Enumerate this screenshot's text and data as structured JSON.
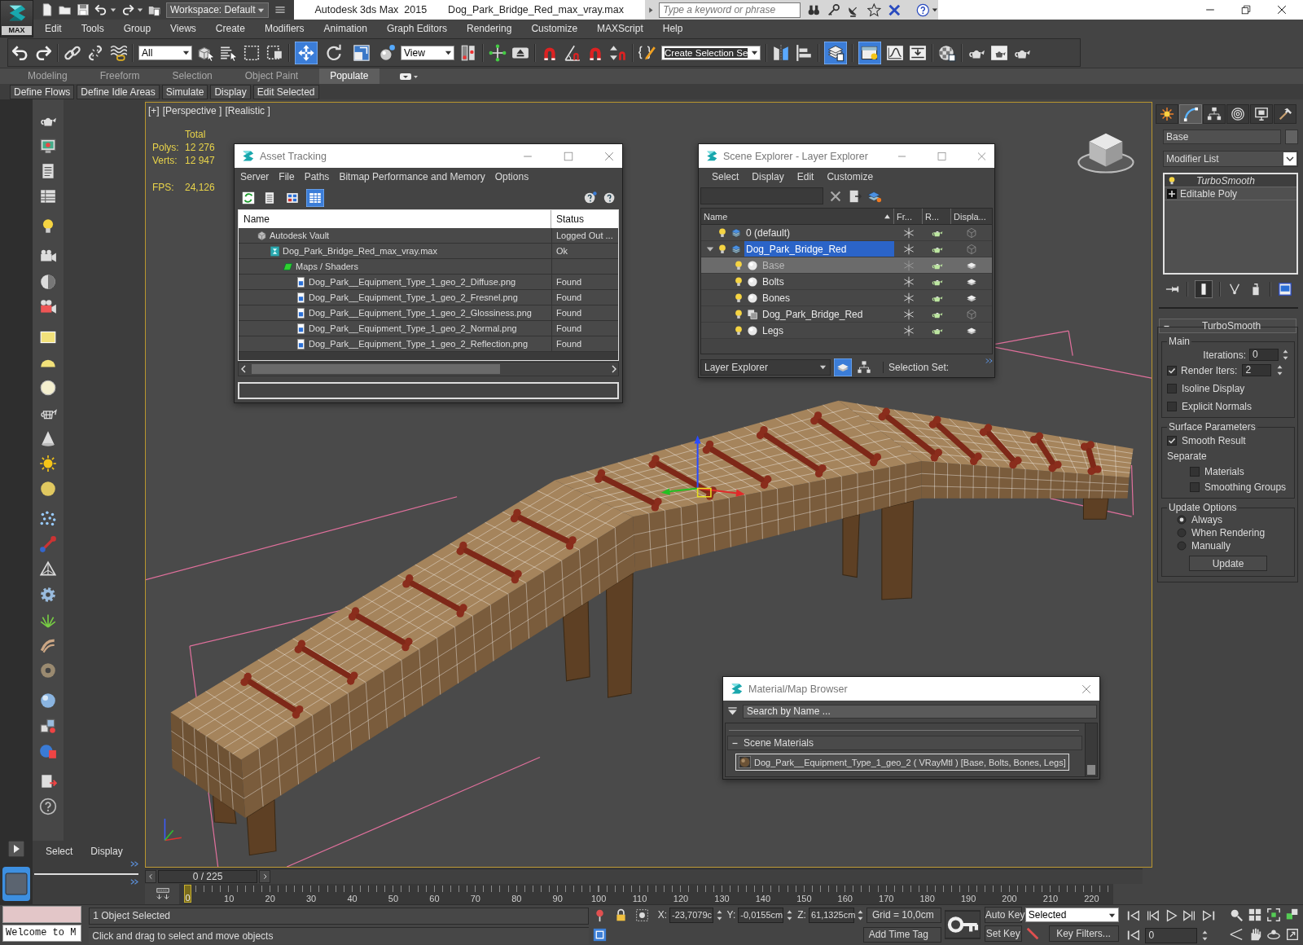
{
  "title_bar": {
    "logo_label": "MAX",
    "workspace": "Workspace: Default",
    "title": "Autodesk 3ds Max  2015",
    "file_name": "Dog_Park_Bridge_Red_max_vray.max",
    "search": {
      "placeholder": "Type a keyword or phrase"
    }
  },
  "menu_bar": [
    "Edit",
    "Tools",
    "Group",
    "Views",
    "Create",
    "Modifiers",
    "Animation",
    "Graph Editors",
    "Rendering",
    "Customize",
    "MAXScript",
    "Help"
  ],
  "main_toolbar": {
    "selection_filter": "All",
    "transform_tools": [
      {
        "selected": true
      },
      {
        "selected": false
      },
      {
        "selected": false
      }
    ],
    "reference_coordinate_system": "View",
    "named_selection_set": "Create Selection Se",
    "explorer_toggles": [
      {
        "on": true
      },
      {
        "on": true
      }
    ]
  },
  "ribbon": {
    "tabs": [
      {
        "label": "Modeling",
        "selected": false
      },
      {
        "label": "Freeform",
        "selected": false
      },
      {
        "label": "Selection",
        "selected": false
      },
      {
        "label": "Object Paint",
        "selected": false
      },
      {
        "label": "Populate",
        "selected": true
      }
    ],
    "buttons": [
      "Define Flows",
      "Define Idle Areas",
      "Simulate",
      "Display",
      "Edit Selected"
    ]
  },
  "left_panel": {
    "menu": [
      "Select",
      "Display"
    ]
  },
  "viewport": {
    "labels": [
      "[+]",
      "[Perspective ]",
      "[Realistic ]"
    ],
    "stats": {
      "heading": "Total",
      "rows": [
        {
          "label": "Polys:",
          "value": "12 276"
        },
        {
          "label": "Verts:",
          "value": "12 947"
        }
      ],
      "fps_label": "FPS:",
      "fps_value": "24,126"
    }
  },
  "asset_tracking": {
    "title": "Asset Tracking",
    "menu": [
      "Server",
      "File",
      "Paths",
      "Bitmap Performance and Memory",
      "Options"
    ],
    "view_modes": [
      {
        "selected": false
      },
      {
        "selected": false
      },
      {
        "selected": true
      }
    ],
    "columns": [
      "Name",
      "Status"
    ],
    "tree": [
      {
        "kind": "vault",
        "name": "Autodesk Vault",
        "status": "Logged Out ...",
        "children": [
          {
            "kind": "scene",
            "name": "Dog_Park_Bridge_Red_max_vray.max",
            "status": "Ok",
            "children": [
              {
                "kind": "folder",
                "name": "Maps / Shaders",
                "children": [
                  {
                    "kind": "bitmap",
                    "name": "Dog_Park__Equipment_Type_1_geo_2_Diffuse.png",
                    "status": "Found"
                  },
                  {
                    "kind": "bitmap",
                    "name": "Dog_Park__Equipment_Type_1_geo_2_Fresnel.png",
                    "status": "Found"
                  },
                  {
                    "kind": "bitmap",
                    "name": "Dog_Park__Equipment_Type_1_geo_2_Glossiness.png",
                    "status": "Found"
                  },
                  {
                    "kind": "bitmap",
                    "name": "Dog_Park__Equipment_Type_1_geo_2_Normal.png",
                    "status": "Found"
                  },
                  {
                    "kind": "bitmap",
                    "name": "Dog_Park__Equipment_Type_1_geo_2_Reflection.png",
                    "status": "Found"
                  }
                ]
              }
            ]
          }
        ]
      }
    ]
  },
  "scene_explorer": {
    "title": "Scene Explorer - Layer Explorer",
    "menu": [
      "Select",
      "Display",
      "Edit",
      "Customize"
    ],
    "columns": [
      "Name",
      "Fr...",
      "R...",
      "Displa..."
    ],
    "tree": [
      {
        "kind": "layer",
        "name": "0 (default)",
        "selected": false,
        "visible": true
      },
      {
        "kind": "layer",
        "name": "Dog_Park_Bridge_Red",
        "selected": true,
        "visible": true,
        "expanded": true,
        "children": [
          {
            "kind": "object",
            "name": "Base",
            "selected": true,
            "visible": true
          },
          {
            "kind": "object",
            "name": "Bolts",
            "selected": false,
            "visible": true
          },
          {
            "kind": "object",
            "name": "Bones",
            "selected": false,
            "visible": true
          },
          {
            "kind": "group",
            "name": "Dog_Park_Bridge_Red",
            "selected": false,
            "visible": true
          },
          {
            "kind": "object",
            "name": "Legs",
            "selected": false,
            "visible": true
          }
        ]
      }
    ],
    "explorer_type": "Layer Explorer",
    "mode_buttons": [
      {
        "selected": true
      },
      {
        "selected": false
      }
    ],
    "selection_set_label": "Selection Set:"
  },
  "material_browser": {
    "title": "Material/Map Browser",
    "search": {
      "placeholder": "Search by Name ..."
    },
    "groups": [
      {
        "name": "Scene Materials",
        "expanded": true,
        "materials": [
          {
            "name": "Dog_Park__Equipment_Type_1_geo_2 ( VRayMtl ) [Base, Bolts, Bones, Legs]",
            "selected": true
          }
        ]
      }
    ]
  },
  "command_panel": {
    "tabs": [
      {
        "selected": false
      },
      {
        "selected": true
      },
      {
        "selected": false
      },
      {
        "selected": false
      },
      {
        "selected": false
      },
      {
        "selected": false
      }
    ],
    "object_name": "Base",
    "modifier_list": "Modifier List",
    "stack": [
      {
        "kind": "modifier",
        "name": "TurboSmooth",
        "selected": true
      },
      {
        "kind": "base_object",
        "name": "Editable Poly",
        "selected": false
      }
    ],
    "show_end_result": {
      "on": true
    },
    "rollout": {
      "title": "TurboSmooth",
      "expanded": true,
      "main": {
        "title": "Main",
        "iterations": {
          "label": "Iterations:",
          "value": "0"
        },
        "render_iters": {
          "label": "Render Iters:",
          "value": "2",
          "checked": true
        },
        "options": [
          {
            "label": "Isoline Display",
            "checked": false
          },
          {
            "label": "Explicit Normals",
            "checked": false
          }
        ]
      },
      "surface": {
        "title": "Surface Parameters",
        "smooth_result": {
          "label": "Smooth Result",
          "checked": true
        },
        "separate_label": "Separate",
        "separate": [
          {
            "label": "Materials",
            "checked": false
          },
          {
            "label": "Smoothing Groups",
            "checked": false
          }
        ]
      },
      "update": {
        "title": "Update Options",
        "options": [
          {
            "label": "Always",
            "selected": true
          },
          {
            "label": "When Rendering",
            "selected": false
          },
          {
            "label": "Manually",
            "selected": false
          }
        ],
        "button": "Update"
      }
    }
  },
  "time_slider": {
    "position": "0 / 225"
  },
  "track_bar": {
    "current_frame": "0",
    "ticks": [
      "10",
      "20",
      "30",
      "40",
      "50",
      "60",
      "70",
      "80",
      "90",
      "100",
      "110",
      "120",
      "130",
      "140",
      "150",
      "160",
      "170",
      "180",
      "190",
      "200",
      "210",
      "220"
    ]
  },
  "status_bar": {
    "listener_output": "Welcome to M",
    "selection_info": "1 Object Selected",
    "prompt": "Click and drag to select and move objects",
    "coordinates": [
      {
        "axis": "X:",
        "value": "-23,7079c"
      },
      {
        "axis": "Y:",
        "value": "-0,0155cm"
      },
      {
        "axis": "Z:",
        "value": "61,1325cm"
      }
    ],
    "grid": "Grid = 10,0cm",
    "add_time_tag": "Add Time Tag",
    "auto_key": "Auto Key",
    "set_key": "Set Key",
    "key_mode": "Selected",
    "key_filters": "Key Filters...",
    "current_frame": "0"
  }
}
